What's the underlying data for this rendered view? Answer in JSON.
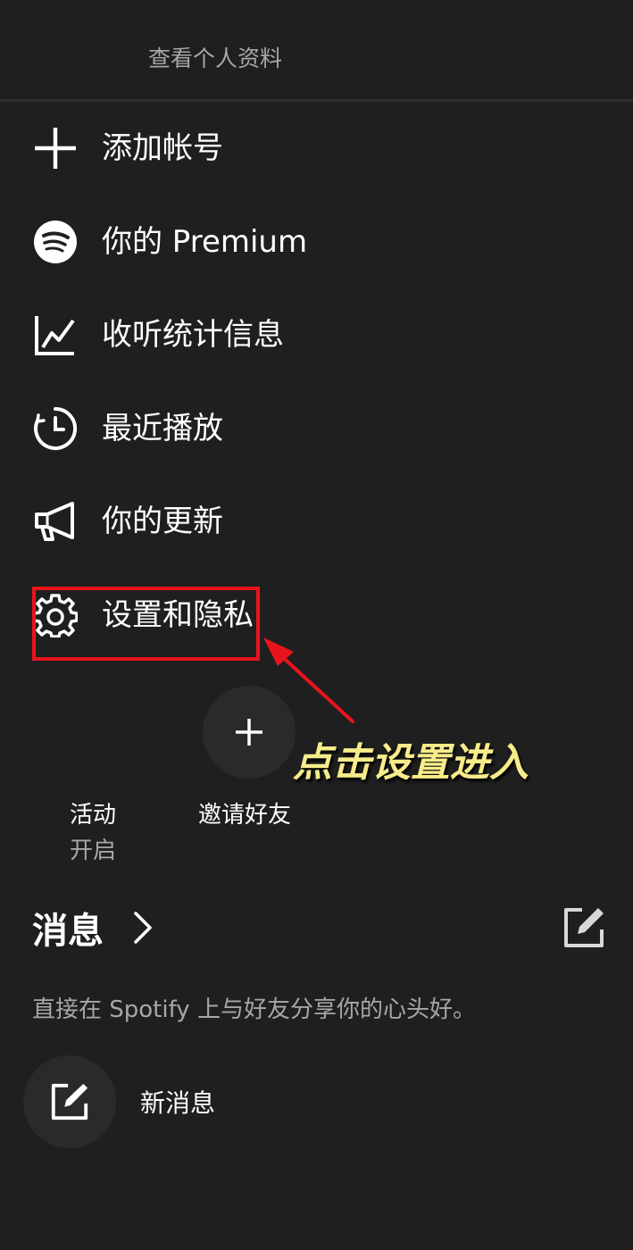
{
  "header": {
    "view_profile": "查看个人资料"
  },
  "menu": {
    "items": [
      {
        "icon": "plus-icon",
        "label": "添加帐号"
      },
      {
        "icon": "spotify-logo-icon",
        "label": "你的 Premium"
      },
      {
        "icon": "stats-chart-icon",
        "label": "收听统计信息"
      },
      {
        "icon": "recent-clock-icon",
        "label": "最近播放"
      },
      {
        "icon": "megaphone-icon",
        "label": "你的更新"
      },
      {
        "icon": "gear-icon",
        "label": "设置和隐私"
      }
    ]
  },
  "annotation": {
    "text": "点击设置进入",
    "color": "#f7ec8a",
    "box_color": "#e8141c"
  },
  "activity": {
    "label": "活动",
    "status": "开启"
  },
  "invite": {
    "label": "邀请好友"
  },
  "messages": {
    "title": "消息",
    "description": "直接在 Spotify 上与好友分享你的心头好。",
    "new_message": "新消息"
  },
  "colors": {
    "background": "#1f1f1f",
    "secondary_text": "#a7a7a7"
  }
}
